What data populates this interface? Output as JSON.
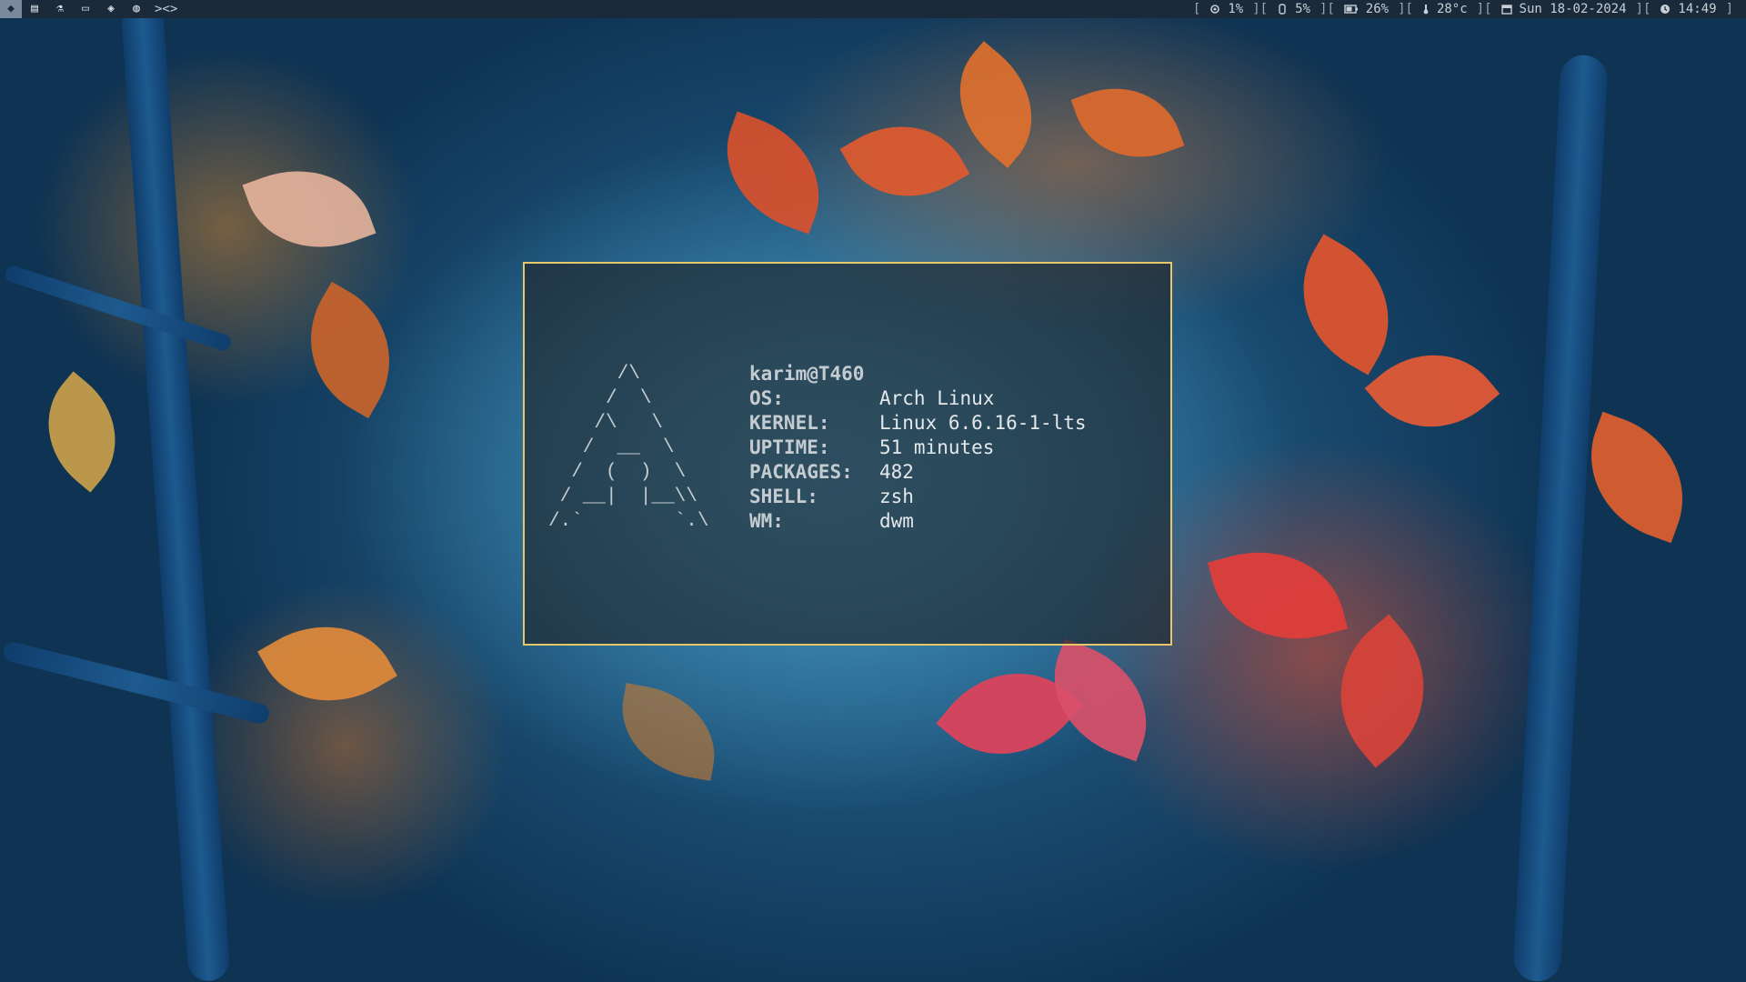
{
  "bar": {
    "tags": [
      {
        "icon": "arch-logo-icon",
        "glyph": "◆",
        "active": true
      },
      {
        "icon": "book-icon",
        "glyph": "▤",
        "active": false
      },
      {
        "icon": "flask-icon",
        "glyph": "⚗",
        "active": false
      },
      {
        "icon": "folder-icon",
        "glyph": "▭",
        "active": false
      },
      {
        "icon": "graduation-cap-icon",
        "glyph": "◈",
        "active": false
      },
      {
        "icon": "globe-icon",
        "glyph": "◍",
        "active": false
      }
    ],
    "layout_symbol": "><>",
    "status": {
      "cpu": "1%",
      "memory": "5%",
      "battery": "26%",
      "temperature": "28°c",
      "date": "Sun 18-02-2024",
      "time": "14:49"
    }
  },
  "terminal": {
    "ascii_logo": "      /\\\n     /  \\\n    /\\   \\\n   /  __  \\\n  /  (  )  \\\n / __|  |__\\\\\n/.`        `.\\",
    "user_host": "karim@T460",
    "fields": [
      {
        "key": "OS:",
        "value": "Arch Linux"
      },
      {
        "key": "KERNEL:",
        "value": "Linux 6.6.16-1-lts"
      },
      {
        "key": "UPTIME:",
        "value": "51 minutes"
      },
      {
        "key": "PACKAGES:",
        "value": "482"
      },
      {
        "key": "SHELL:",
        "value": "zsh"
      },
      {
        "key": "WM:",
        "value": "dwm"
      }
    ]
  },
  "colors": {
    "bar_bg": "#1b2a3a",
    "terminal_border": "#e6c86a",
    "accent_leaf": "#e0542c"
  }
}
